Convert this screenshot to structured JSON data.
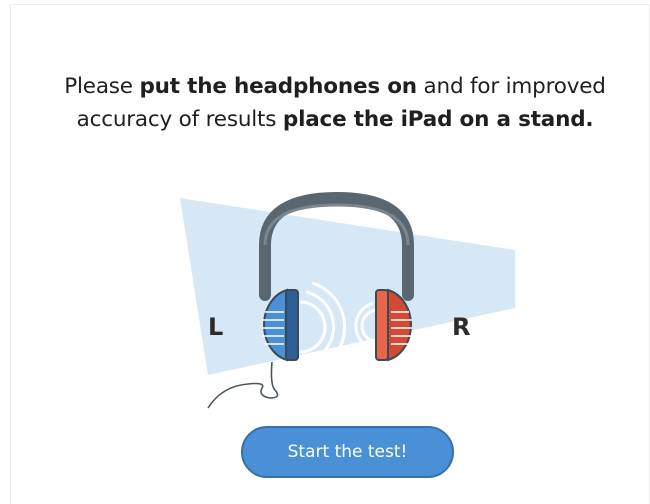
{
  "instruction": {
    "part1": "Please ",
    "bold1": "put the headphones on",
    "part2": " and for improved accuracy of results ",
    "bold2": "place the iPad on a stand."
  },
  "labels": {
    "left": "L",
    "right": "R"
  },
  "button": {
    "label": "Start the test!"
  },
  "colors": {
    "accent": "#4a90d6",
    "left_cup": "#4a90d6",
    "right_cup": "#e8674a",
    "band": "#5a6670",
    "beam": "#d6e8f6"
  },
  "icons": {
    "illustration": "headphones-illustration"
  }
}
